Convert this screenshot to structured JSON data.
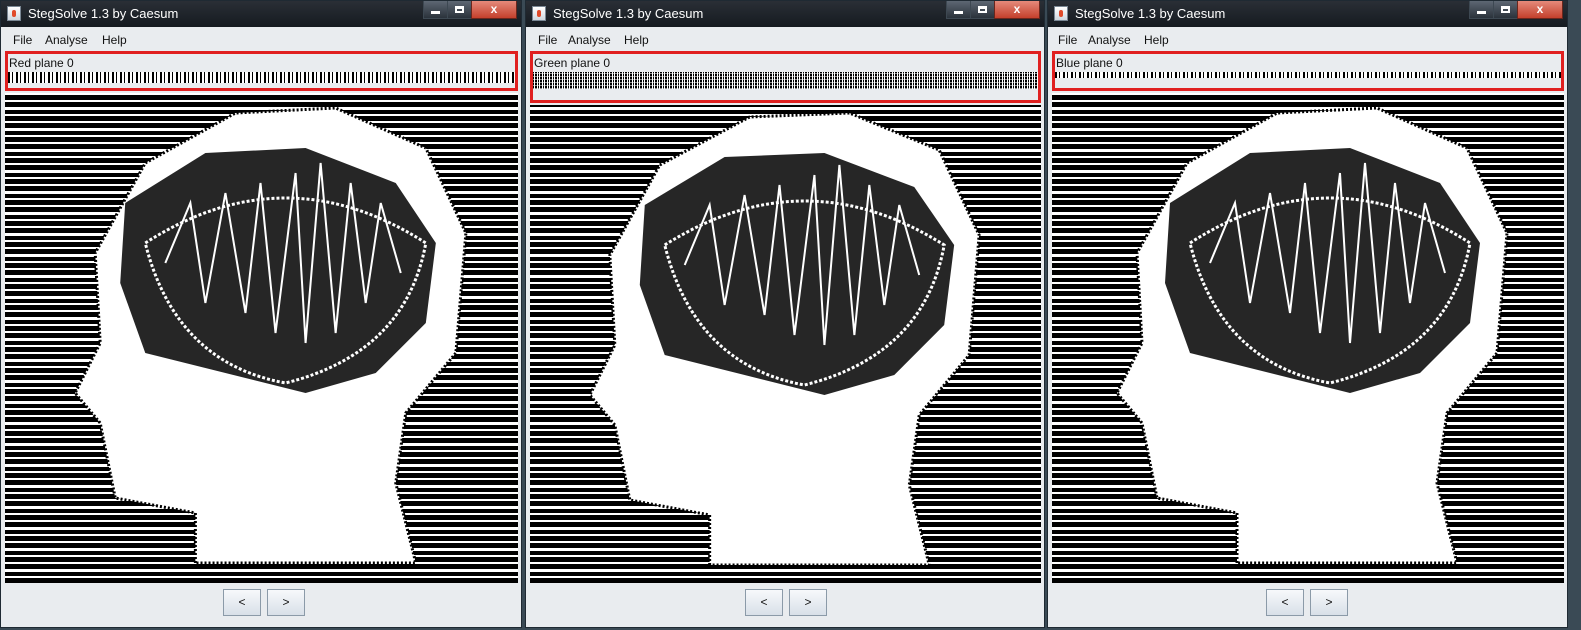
{
  "windows": [
    {
      "title": "StegSolve 1.3 by Caesum",
      "plane_label": "Red plane 0",
      "menu": {
        "file": "File",
        "analyse": "Analyse",
        "help": "Help"
      },
      "controls": {
        "close": "x"
      },
      "nav": {
        "prev": "<",
        "next": ">"
      }
    },
    {
      "title": "StegSolve 1.3 by Caesum",
      "plane_label": "Green plane 0",
      "menu": {
        "file": "File",
        "analyse": "Analyse",
        "help": "Help"
      },
      "controls": {
        "close": "x"
      },
      "nav": {
        "prev": "<",
        "next": ">"
      }
    },
    {
      "title": "StegSolve 1.3 by Caesum",
      "plane_label": "Blue plane 0",
      "menu": {
        "file": "File",
        "analyse": "Analyse",
        "help": "Help"
      },
      "controls": {
        "close": "x"
      },
      "nav": {
        "prev": "<",
        "next": ">"
      }
    }
  ],
  "colors": {
    "highlight_box": "#e02020",
    "window_bg": "#e9ecef",
    "titlebar": "#1b2027"
  },
  "icons": [
    "app-icon",
    "minimize-icon",
    "maximize-icon",
    "close-icon"
  ]
}
